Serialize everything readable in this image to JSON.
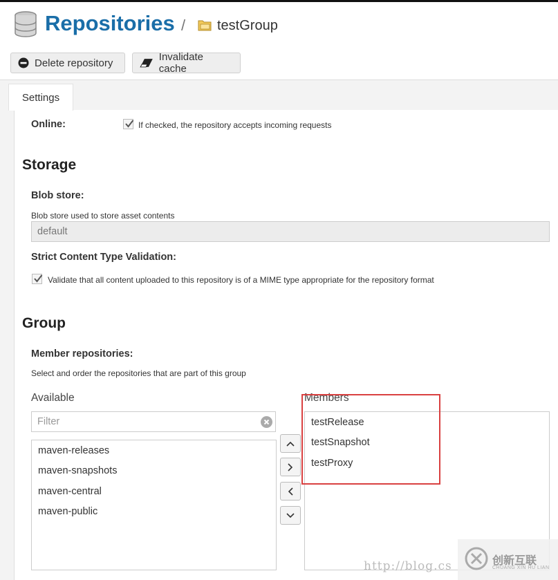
{
  "header": {
    "title": "Repositories",
    "separator": "/",
    "group_name": "testGroup"
  },
  "toolbar": {
    "delete_label": "Delete repository",
    "invalidate_label": "Invalidate cache"
  },
  "tabs": [
    {
      "label": "Settings",
      "active": true
    }
  ],
  "online": {
    "label": "Online:",
    "checked": true,
    "help": "If checked, the repository accepts incoming requests"
  },
  "storage": {
    "heading": "Storage",
    "blob_label": "Blob store:",
    "blob_help": "Blob store used to store asset contents",
    "blob_value": "default",
    "strict_label": "Strict Content Type Validation:",
    "strict_checked": true,
    "strict_help": "Validate that all content uploaded to this repository is of a MIME type appropriate for the repository format"
  },
  "group": {
    "heading": "Group",
    "members_label": "Member repositories:",
    "members_help": "Select and order the repositories that are part of this group",
    "available_label": "Available",
    "members_list_label": "Members",
    "filter_placeholder": "Filter",
    "available": [
      "maven-releases",
      "maven-snapshots",
      "maven-central",
      "maven-public"
    ],
    "members": [
      "testRelease",
      "testSnapshot",
      "testProxy"
    ]
  },
  "watermark": {
    "url_text": "http://blog.cs",
    "logo_text": "创新互联",
    "logo_sub": "CHUANG XIN HU LIAN"
  },
  "colors": {
    "title": "#1a6ea8",
    "highlight_box": "#d94040"
  }
}
